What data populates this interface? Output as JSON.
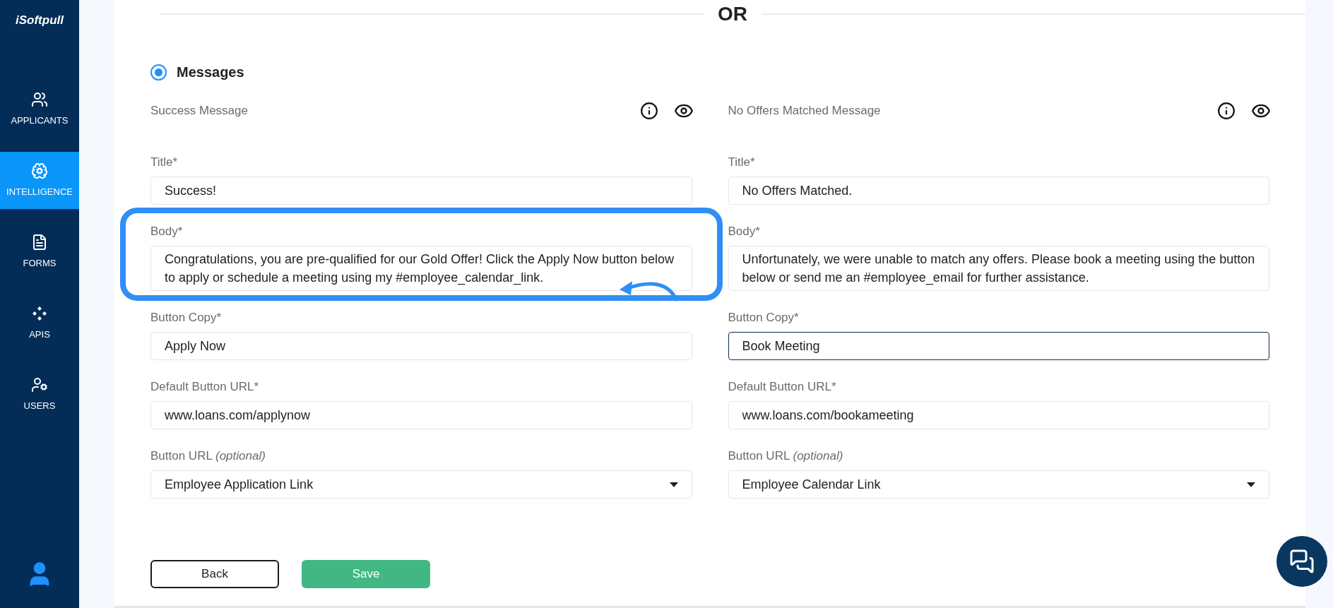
{
  "sidebar": {
    "logo": "iSoftpull",
    "items": [
      {
        "kind": "applicants",
        "label": "APPLICANTS",
        "selected": false
      },
      {
        "kind": "intelligence",
        "label": "INTELLIGENCE",
        "selected": true
      },
      {
        "kind": "forms",
        "label": "FORMS",
        "selected": false
      },
      {
        "kind": "apis",
        "label": "APIS",
        "selected": false
      },
      {
        "kind": "users",
        "label": "USERS",
        "selected": false
      }
    ]
  },
  "divider_label": "OR",
  "section": {
    "label": "Messages",
    "selected": true
  },
  "panels": [
    {
      "heading": "Success Message",
      "fields": [
        {
          "kind": "input",
          "label": "Title*",
          "value": "Success!",
          "focused": false
        },
        {
          "kind": "textarea",
          "label": "Body*",
          "value": "Congratulations, you are pre-qualified for our Gold Offer! Click the Apply Now button below to apply or schedule a meeting using my #employee_calendar_link.",
          "highlighted": true
        },
        {
          "kind": "input",
          "label": "Button Copy*",
          "value": "Apply Now",
          "focused": false
        },
        {
          "kind": "input",
          "label": "Default Button URL*",
          "value": "www.loans.com/applynow",
          "focused": false
        },
        {
          "kind": "select",
          "label": "Button URL *(optional)*",
          "value": "Employee Application Link"
        }
      ]
    },
    {
      "heading": "No Offers Matched Message",
      "fields": [
        {
          "kind": "input",
          "label": "Title*",
          "value": "No Offers Matched.",
          "focused": false
        },
        {
          "kind": "textarea",
          "label": "Body*",
          "value": "Unfortunately, we were unable to match any offers. Please book a meeting using the button below or send me an #employee_email for further assistance.",
          "highlighted": false
        },
        {
          "kind": "input",
          "label": "Button Copy*",
          "value": "Book Meeting",
          "focused": true
        },
        {
          "kind": "input",
          "label": "Default Button URL*",
          "value": "www.loans.com/bookameeting",
          "focused": false
        },
        {
          "kind": "select",
          "label": "Button URL *(optional)*",
          "value": "Employee Calendar Link"
        }
      ]
    }
  ],
  "buttons": [
    {
      "kind": "outline",
      "label": "Back"
    },
    {
      "kind": "primary",
      "label": "Save"
    }
  ]
}
